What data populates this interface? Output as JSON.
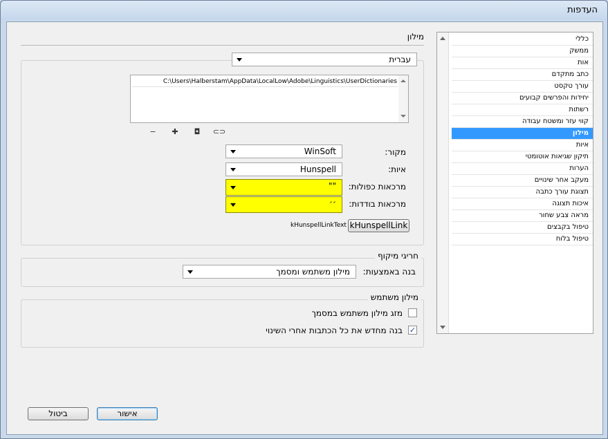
{
  "window": {
    "title": "העדפות"
  },
  "categories": [
    {
      "label": "כללי",
      "selected": false
    },
    {
      "label": "ממשק",
      "selected": false
    },
    {
      "label": "אות",
      "selected": false
    },
    {
      "label": "כתב מתקדם",
      "selected": false
    },
    {
      "label": "עורך טקסט",
      "selected": false
    },
    {
      "label": "יחידות והפרשים קבועים",
      "selected": false
    },
    {
      "label": "רשתות",
      "selected": false
    },
    {
      "label": "קווי עזר ומשטח עבודה",
      "selected": false
    },
    {
      "label": "מילון",
      "selected": true
    },
    {
      "label": "איות",
      "selected": false
    },
    {
      "label": "תיקון שגיאות אוטומטי",
      "selected": false
    },
    {
      "label": "הערות",
      "selected": false
    },
    {
      "label": "מעקב אחר שינויים",
      "selected": false
    },
    {
      "label": "תצוגת עורך כתבה",
      "selected": false
    },
    {
      "label": "איכות תצוגה",
      "selected": false
    },
    {
      "label": "מראה צבע שחור",
      "selected": false
    },
    {
      "label": "טיפול בקבצים",
      "selected": false
    },
    {
      "label": "טיפול בלוח",
      "selected": false
    }
  ],
  "dictionary": {
    "section_title": "מילון",
    "language_value": "עברית",
    "path": "C:\\Users\\Halberstam\\AppData\\LocalLow\\Adobe\\Linguistics\\UserDictionaries",
    "icons": {
      "remove": "−",
      "add": "✚",
      "new": "◘",
      "relink": "⊂⊃"
    },
    "vendor_label": "מקור:",
    "vendor_value": "WinSoft",
    "spelling_label": "איות:",
    "spelling_value": "Hunspell",
    "double_quotes_label": "מרכאות כפולות:",
    "double_quotes_value": "\"\"",
    "single_quotes_label": "מרכאות בודדות:",
    "single_quotes_value": "׳׳",
    "link_text": "kHunspellLinkText",
    "link_button": "kHunspellLink"
  },
  "hyphenation": {
    "section_title": "חריגי מיקוף",
    "compose_label": "בנה באמצעות:",
    "compose_value": "מילון משתמש ומסמך"
  },
  "user_dictionary": {
    "section_title": "מילון משתמש",
    "merge_label": "מזג מילון משתמש במסמך",
    "merge_checked": false,
    "recompose_label": "בנה מחדש את כל הכתבות אחרי השינוי",
    "recompose_checked": true
  },
  "buttons": {
    "ok": "אישור",
    "cancel": "ביטול"
  },
  "colors": {
    "selection": "#3399ff",
    "highlight": "#ffff00"
  }
}
